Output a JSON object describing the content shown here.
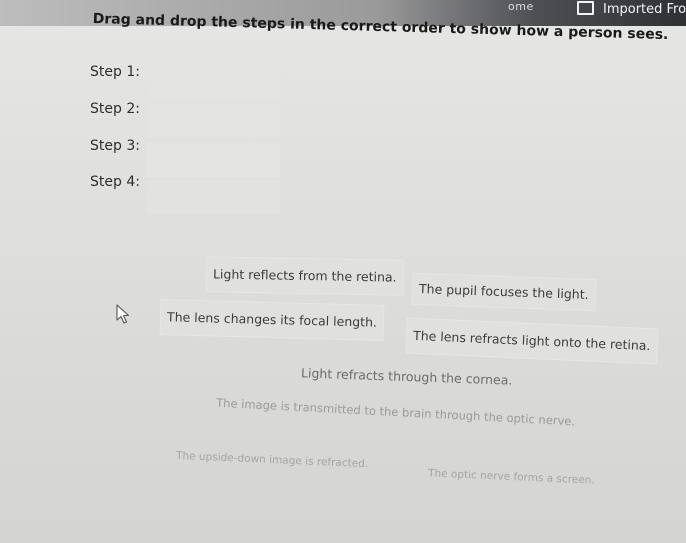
{
  "topbar": {
    "home_label": "ome",
    "imported_label": "Imported Fro"
  },
  "instruction": "Drag and drop the steps in the correct order to show how a person sees.",
  "steps": [
    {
      "label": "Step 1:"
    },
    {
      "label": "Step 2:"
    },
    {
      "label": "Step 3:"
    },
    {
      "label": "Step 4:"
    }
  ],
  "options": [
    "Light reflects from the retina.",
    "The pupil focuses the light.",
    "The lens changes its focal length.",
    "The lens refracts light onto the retina.",
    "Light refracts through the cornea.",
    "The image is transmitted to the brain through the optic nerve.",
    "The upside-down image is refracted.",
    "The optic nerve forms a screen."
  ],
  "icons": {
    "bookmark": "bookmark-icon",
    "cursor": "mouse-pointer-icon"
  }
}
